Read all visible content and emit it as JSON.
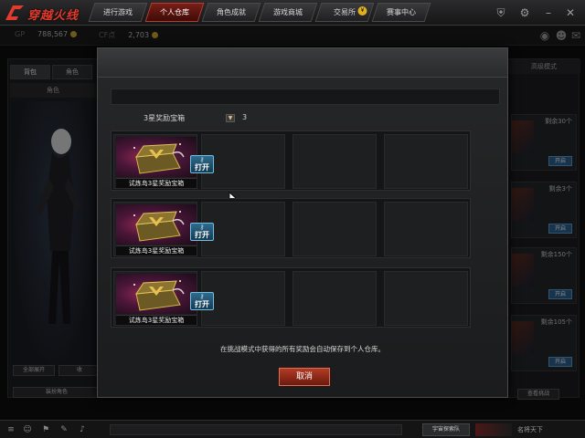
{
  "app": {
    "title": "穿越火线",
    "accent_color": "#e23a2c"
  },
  "nav": {
    "tabs": [
      {
        "label": "进行游戏"
      },
      {
        "label": "个人仓库",
        "active": true
      },
      {
        "label": "角色成就"
      },
      {
        "label": "游戏商城"
      },
      {
        "label": "交易所"
      },
      {
        "label": "赛事中心"
      }
    ],
    "icons": [
      "shield-icon",
      "settings-icon",
      "minimize-icon",
      "close-icon"
    ]
  },
  "currency": {
    "gp_label": "GP",
    "gp_value": "788,567",
    "cf_label": "CF点",
    "cf_value": "2,703"
  },
  "left": {
    "tabs": [
      "背包",
      "角色"
    ],
    "sub_label": "角色",
    "buttons": [
      "全部展开",
      "收"
    ],
    "bottom_button": "装扮角色"
  },
  "right": {
    "header": "高级模式",
    "items": [
      {
        "remain": "剩余30个",
        "open": "开启"
      },
      {
        "remain": "剩余3个",
        "open": "开启"
      },
      {
        "remain": "剩余150个",
        "open": "开启"
      },
      {
        "remain": "剩余105个",
        "open": "开启"
      }
    ],
    "bottom_button": "查看挑战"
  },
  "bottombar": {
    "chat_label": "宇宙探索队",
    "name_label": "名将天下"
  },
  "modal": {
    "select": {
      "label": "3星奖励宝箱",
      "count": "3"
    },
    "rows": [
      {
        "item_name": "试炼岛3星奖励宝箱",
        "open_label": "打开"
      },
      {
        "item_name": "试炼岛3星奖励宝箱",
        "open_label": "打开"
      },
      {
        "item_name": "试炼岛3星奖励宝箱",
        "open_label": "打开"
      }
    ],
    "note": "在挑战模式中获得的所有奖励会自动保存到个人仓库。",
    "cancel_label": "取消"
  }
}
